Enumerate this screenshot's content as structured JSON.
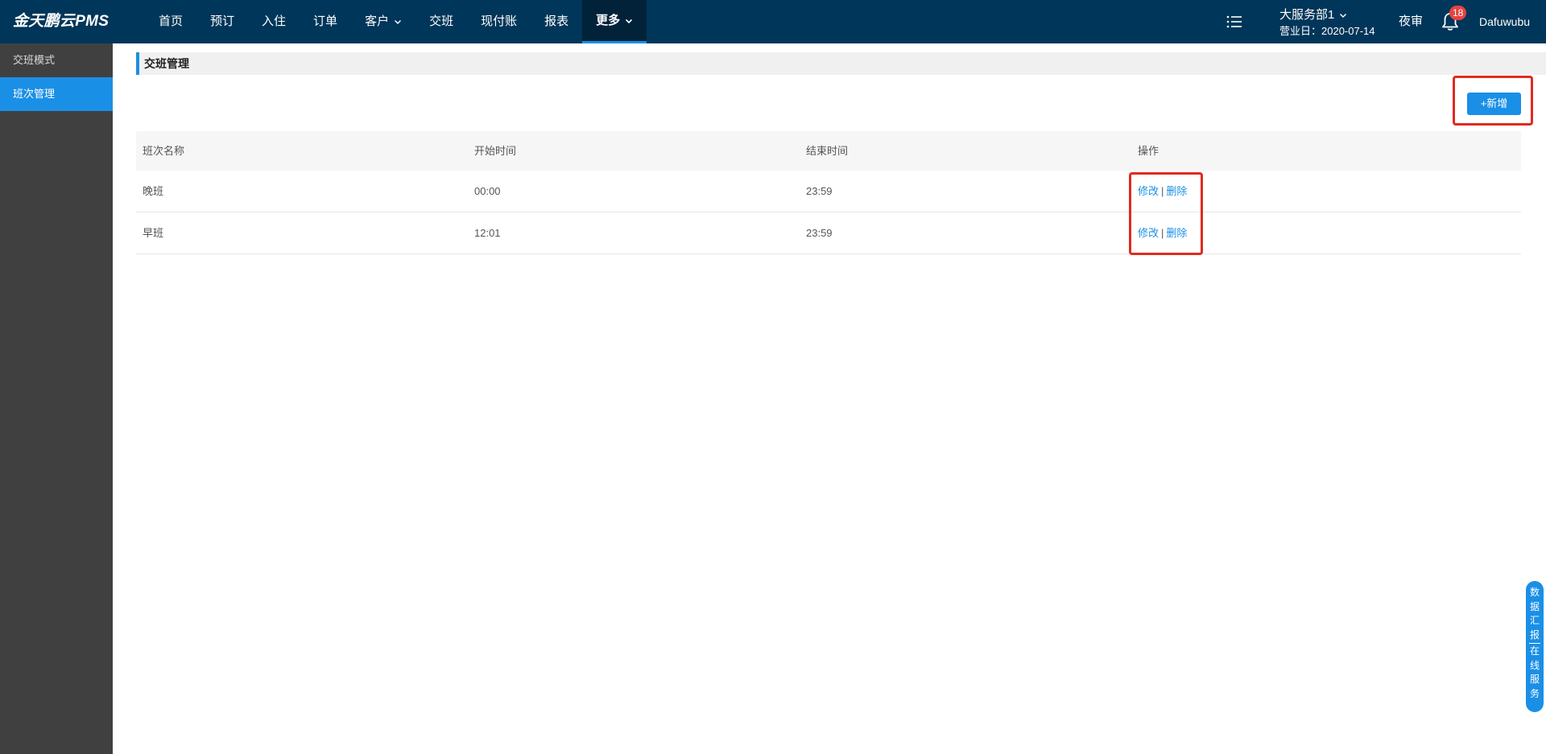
{
  "app": {
    "brand": "金天鹏云PMS"
  },
  "nav": {
    "items": [
      {
        "label": "首页",
        "active": false,
        "has_dropdown": false
      },
      {
        "label": "预订",
        "active": false,
        "has_dropdown": false
      },
      {
        "label": "入住",
        "active": false,
        "has_dropdown": false
      },
      {
        "label": "订单",
        "active": false,
        "has_dropdown": false
      },
      {
        "label": "客户",
        "active": false,
        "has_dropdown": true
      },
      {
        "label": "交班",
        "active": false,
        "has_dropdown": false
      },
      {
        "label": "现付账",
        "active": false,
        "has_dropdown": false
      },
      {
        "label": "报表",
        "active": false,
        "has_dropdown": false
      },
      {
        "label": "更多",
        "active": true,
        "has_dropdown": true
      }
    ]
  },
  "header": {
    "menu_icon": "list-icon",
    "department": "大服务部1",
    "business_date": "营业日：2020-07-14",
    "night_audit": "夜审",
    "bell_icon": "bell-icon",
    "notification_count": "18",
    "username": "Dafuwubu"
  },
  "sidebar": {
    "items": [
      {
        "label": "交班模式",
        "active": false
      },
      {
        "label": "班次管理",
        "active": true
      }
    ]
  },
  "page": {
    "title": "交班管理",
    "add_button": "+新增"
  },
  "table": {
    "columns": [
      "班次名称",
      "开始时间",
      "结束时间",
      "操作"
    ],
    "rows": [
      {
        "name": "晚班",
        "start": "00:00",
        "end": "23:59",
        "edit": "修改",
        "sep": "|",
        "delete": "删除"
      },
      {
        "name": "早班",
        "start": "12:01",
        "end": "23:59",
        "edit": "修改",
        "sep": "|",
        "delete": "删除"
      }
    ]
  },
  "float_tab": {
    "data_report": [
      "数",
      "据",
      "汇",
      "报"
    ],
    "online_service": [
      "在",
      "线",
      "服",
      "务"
    ]
  },
  "colors": {
    "topbar": "#003659",
    "accent": "#1a8fe6",
    "sidebar": "#404040",
    "highlight": "#e02b20",
    "badge": "#e64340"
  }
}
